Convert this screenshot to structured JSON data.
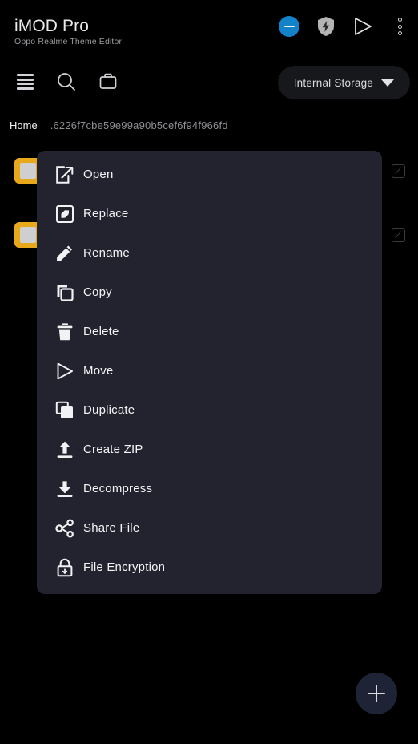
{
  "app": {
    "title": "iMOD Pro",
    "subtitle": "Oppo Realme Theme Editor"
  },
  "header": {
    "actions": [
      {
        "name": "minus-circle-icon",
        "label": "",
        "color": "#1283c8"
      },
      {
        "name": "shield-bolt-icon",
        "label": "",
        "color": "#b3b3b3"
      },
      {
        "name": "play-triangle-icon",
        "label": "",
        "color": "#e0e0e4"
      },
      {
        "name": "overflow-menu-icon",
        "label": "",
        "color": "#d9d9dd"
      }
    ]
  },
  "toolbar": {
    "icons": [
      {
        "name": "list-menu-icon"
      },
      {
        "name": "search-icon"
      },
      {
        "name": "briefcase-icon"
      }
    ],
    "storage_selector": {
      "label": "Internal Storage",
      "icon": "chevron-down-icon"
    }
  },
  "breadcrumb": {
    "home": "Home",
    "path": ".6226f7cbe59e99a90b5cef6f94f966fd"
  },
  "file_rows": [
    {
      "icon": "folder-icon",
      "edit_icon": "edit-square-icon"
    },
    {
      "icon": "folder-icon",
      "edit_icon": "edit-square-icon"
    }
  ],
  "context_menu": {
    "items": [
      {
        "label": "Open",
        "icon": "open-external-icon"
      },
      {
        "label": "Replace",
        "icon": "edit-square-filled-icon"
      },
      {
        "label": "Rename",
        "icon": "pencil-icon"
      },
      {
        "label": "Copy",
        "icon": "copy-icon"
      },
      {
        "label": "Delete",
        "icon": "trash-icon"
      },
      {
        "label": "Move",
        "icon": "play-triangle-icon"
      },
      {
        "label": "Duplicate",
        "icon": "duplicate-icon"
      },
      {
        "label": "Create ZIP",
        "icon": "upload-arrow-icon"
      },
      {
        "label": "Decompress",
        "icon": "download-arrow-icon"
      },
      {
        "label": "Share File",
        "icon": "share-nodes-icon"
      },
      {
        "label": "File Encryption",
        "icon": "lock-icon"
      }
    ]
  },
  "fab": {
    "icon": "plus-icon",
    "color": "#1e2435"
  },
  "colors": {
    "background": "#000000",
    "menu_surface": "#22232e",
    "accent_blue": "#1283c8",
    "folder_yellow": "#e8a81c",
    "text_primary": "#f4f4f6",
    "text_secondary": "#8e8e93"
  }
}
